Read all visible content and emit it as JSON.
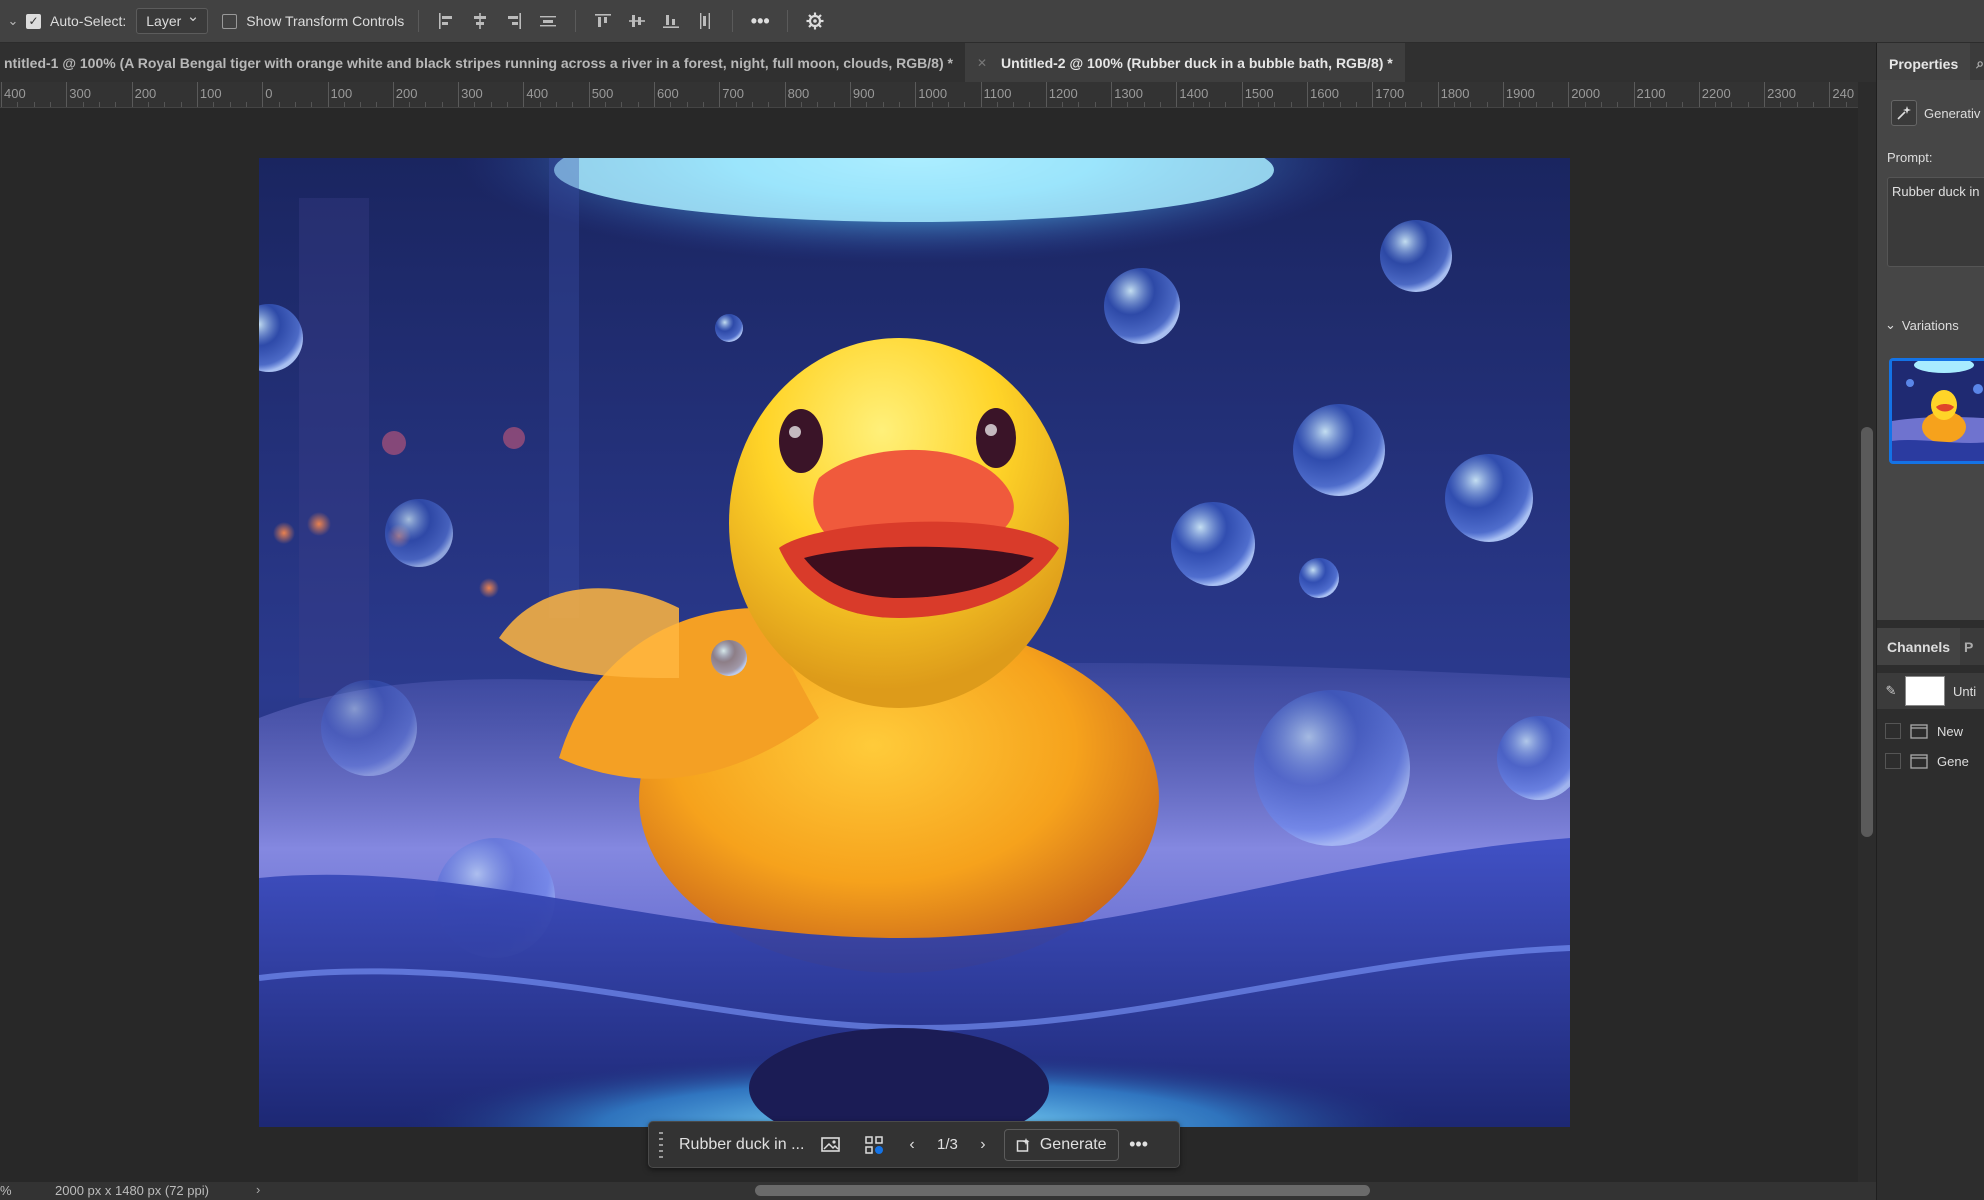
{
  "options_bar": {
    "auto_select_label": "Auto-Select:",
    "auto_select_checked": true,
    "auto_select_target": "Layer",
    "show_transform_label": "Show Transform Controls",
    "show_transform_checked": false,
    "icons": [
      "align-left-icon",
      "align-center-h-icon",
      "align-right-icon",
      "distribute-h-icon",
      "align-top-icon",
      "align-middle-v-icon",
      "align-bottom-icon",
      "distribute-v-icon",
      "more-icon",
      "settings-gear-icon"
    ]
  },
  "tabs": [
    {
      "label": "ntitled-1 @ 100% (A Royal Bengal tiger with orange white and black stripes running across a river in a forest, night, full moon, clouds, RGB/8) *",
      "active": false
    },
    {
      "label": "Untitled-2 @ 100% (Rubber duck in a bubble bath, RGB/8) *",
      "active": true
    }
  ],
  "ruler": {
    "ticks": [
      "400",
      "300",
      "200",
      "100",
      "0",
      "100",
      "200",
      "300",
      "400",
      "500",
      "600",
      "700",
      "800",
      "900",
      "1000",
      "1100",
      "1200",
      "1300",
      "1400",
      "1500",
      "1600",
      "1700",
      "1800",
      "1900",
      "2000",
      "2100",
      "2200",
      "2300",
      "240"
    ]
  },
  "canvas": {
    "image_description": "Yellow rubber duck in a bubble bath"
  },
  "contextual_taskbar": {
    "prompt": "Rubber duck in ...",
    "counter": "1/3",
    "generate_label": "Generate",
    "more": "•••"
  },
  "status_bar": {
    "zoom": "%",
    "doc_info": "2000 px x 1480 px (72 ppi)",
    "arrow": "›"
  },
  "properties_panel": {
    "tab_active": "Properties",
    "layer_type": "Generativ",
    "prompt_label": "Prompt:",
    "prompt_text": "Rubber duck in",
    "variations_label": "Variations"
  },
  "channels_panel": {
    "tab_active": "Channels",
    "tab_inactive": "P",
    "layers": [
      {
        "name": "Unti"
      },
      {
        "name": "New"
      },
      {
        "name": "Gene"
      }
    ]
  },
  "colors": {
    "accent_blue": "#1473e6",
    "panel_bg": "#2d2d2d",
    "toolbar_bg": "#424242"
  }
}
